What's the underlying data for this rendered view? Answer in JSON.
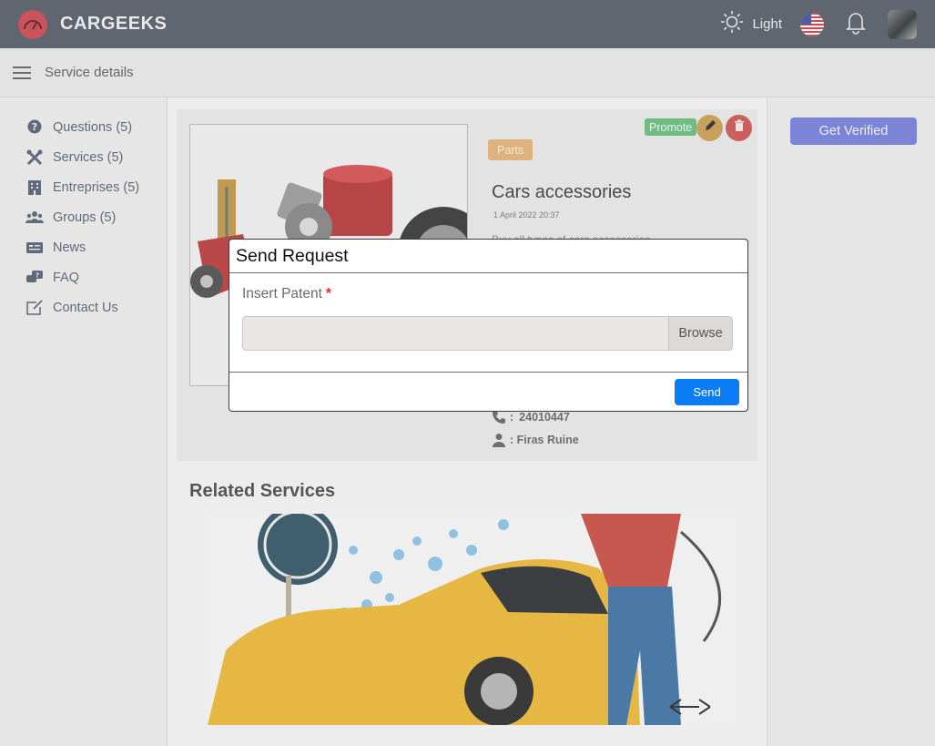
{
  "header": {
    "app_name": "CARGEEKS",
    "theme_label": "Light",
    "icons": [
      "speedometer-logo-icon",
      "sun-icon",
      "us-flag-icon",
      "bell-icon",
      "user-avatar"
    ]
  },
  "subbar": {
    "title": "Service details"
  },
  "sidebar": {
    "items": [
      {
        "label": "Questions (5)",
        "icon": "question-circle-icon"
      },
      {
        "label": "Services (5)",
        "icon": "tools-icon"
      },
      {
        "label": "Entreprises (5)",
        "icon": "building-icon"
      },
      {
        "label": "Groups (5)",
        "icon": "users-icon"
      },
      {
        "label": "News",
        "icon": "newspaper-icon"
      },
      {
        "label": "FAQ",
        "icon": "chat-question-icon"
      },
      {
        "label": "Contact Us",
        "icon": "edit-box-icon"
      }
    ]
  },
  "right_panel": {
    "verify_label": "Get Verified"
  },
  "service": {
    "promote_label": "Promote",
    "badge": "Parts",
    "title": "Cars accessories",
    "date": "1 April 2022 20:37",
    "description": "Buy all types of cars accessories",
    "phone_sep": ":",
    "phone": "24010447",
    "owner": ": Firas Ruine"
  },
  "related": {
    "title": "Related Services"
  },
  "modal": {
    "title": "Send Request",
    "field_label": "Insert Patent",
    "required_mark": "*",
    "file_value": "",
    "browse_label": "Browse",
    "send_label": "Send"
  },
  "colors": {
    "topbar": "#5f6670",
    "accent_verify": "#7b84d6",
    "promote": "#6fbb82",
    "parts_badge": "#ddb27d",
    "send_button": "#0a7cf6"
  }
}
